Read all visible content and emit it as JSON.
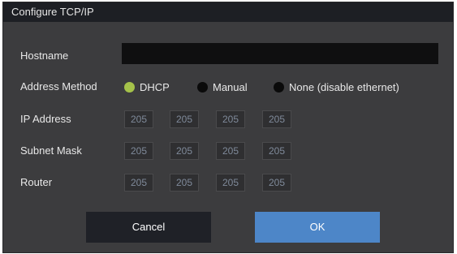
{
  "dialog": {
    "title": "Configure TCP/IP"
  },
  "hostname": {
    "label": "Hostname",
    "value": ""
  },
  "address_method": {
    "label": "Address Method",
    "options": [
      {
        "label": "DHCP",
        "selected": true
      },
      {
        "label": "Manual",
        "selected": false
      },
      {
        "label": "None (disable ethernet)",
        "selected": false
      }
    ]
  },
  "ip_address": {
    "label": "IP Address",
    "octets": [
      "205",
      "205",
      "205",
      "205"
    ]
  },
  "subnet_mask": {
    "label": "Subnet Mask",
    "octets": [
      "205",
      "205",
      "205",
      "205"
    ]
  },
  "router": {
    "label": "Router",
    "octets": [
      "205",
      "205",
      "205",
      "205"
    ]
  },
  "buttons": {
    "cancel": "Cancel",
    "ok": "OK"
  },
  "colors": {
    "background": "#3c3c3e",
    "title_bar": "#1d1f24",
    "ok_button": "#4d86c8",
    "cancel_button": "#1f2127",
    "radio_selected": "#a5c24a",
    "radio_unselected": "#0a0a0a"
  }
}
